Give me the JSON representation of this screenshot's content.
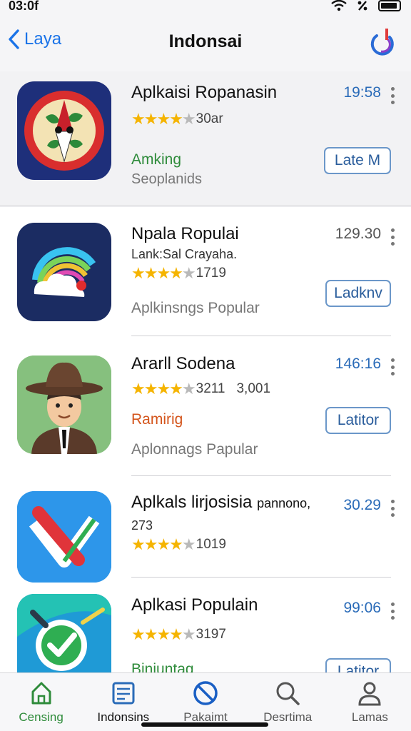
{
  "status_bar": {
    "time": "03:0f",
    "icons": [
      "signal-icon",
      "wifi-icon",
      "percent-icon",
      "battery-icon"
    ]
  },
  "nav": {
    "back_label": "Laya",
    "title": "Indonsai",
    "action_icon": "refresh-icon"
  },
  "apps": [
    {
      "name": "Aplkaisi Ropanasin",
      "subtitle": "",
      "stars": 4,
      "rating_count": "30ar",
      "rating_extra": "",
      "label": "Amking",
      "label_color": "#2e8b3a",
      "label2": "Seoplanids",
      "time": "19:58",
      "action": "Late M",
      "icon": "compass-leaf-icon",
      "highlighted": true
    },
    {
      "name": "Npala Ropulai",
      "subtitle": "Lank:Sal Crayaha.",
      "stars": 4,
      "rating_count": "1719",
      "rating_extra": "",
      "label": "Aplkinsngs Popular",
      "label_color": "#777777",
      "label2": "",
      "time": "129.30",
      "action": "Ladknv",
      "icon": "rainbow-cloud-icon",
      "highlighted": false
    },
    {
      "name": "Ararll Sodena",
      "subtitle": "",
      "stars": 4,
      "rating_count": "3211",
      "rating_extra": "3,001",
      "label": "Ramirig",
      "label_color": "#d4551c",
      "label2": "Aplonnags Papular",
      "time": "146:16",
      "action": "Latitor",
      "icon": "cowboy-avatar-icon",
      "highlighted": false
    },
    {
      "name": "Aplkals lirjosisia",
      "name_suffix": "pannono,",
      "subtitle": "273",
      "stars": 4,
      "rating_count": "1019",
      "rating_extra": "",
      "label": "",
      "label_color": "#777777",
      "label2": "",
      "time": "30.29",
      "action": "",
      "icon": "red-check-icon",
      "highlighted": false
    },
    {
      "name": "Aplkasi Populain",
      "subtitle": "",
      "stars": 4,
      "rating_count": "3197",
      "rating_extra": "",
      "label": "Biniuntag",
      "label_color": "#2e8b3a",
      "label2": "",
      "time": "99:06",
      "action": "Latitor",
      "icon": "wrench-check-icon",
      "highlighted": false
    }
  ],
  "tabs": [
    {
      "label": "Censing",
      "icon": "home-icon"
    },
    {
      "label": "Indonsins",
      "icon": "news-icon"
    },
    {
      "label": "Pakaimt",
      "icon": "blocked-icon"
    },
    {
      "label": "Desrtima",
      "icon": "search-icon"
    },
    {
      "label": "Lamas",
      "icon": "person-icon"
    }
  ],
  "colors": {
    "accent": "#1a73e8",
    "star": "#f5b400",
    "green": "#2e8b3a",
    "orange": "#d4551c"
  }
}
